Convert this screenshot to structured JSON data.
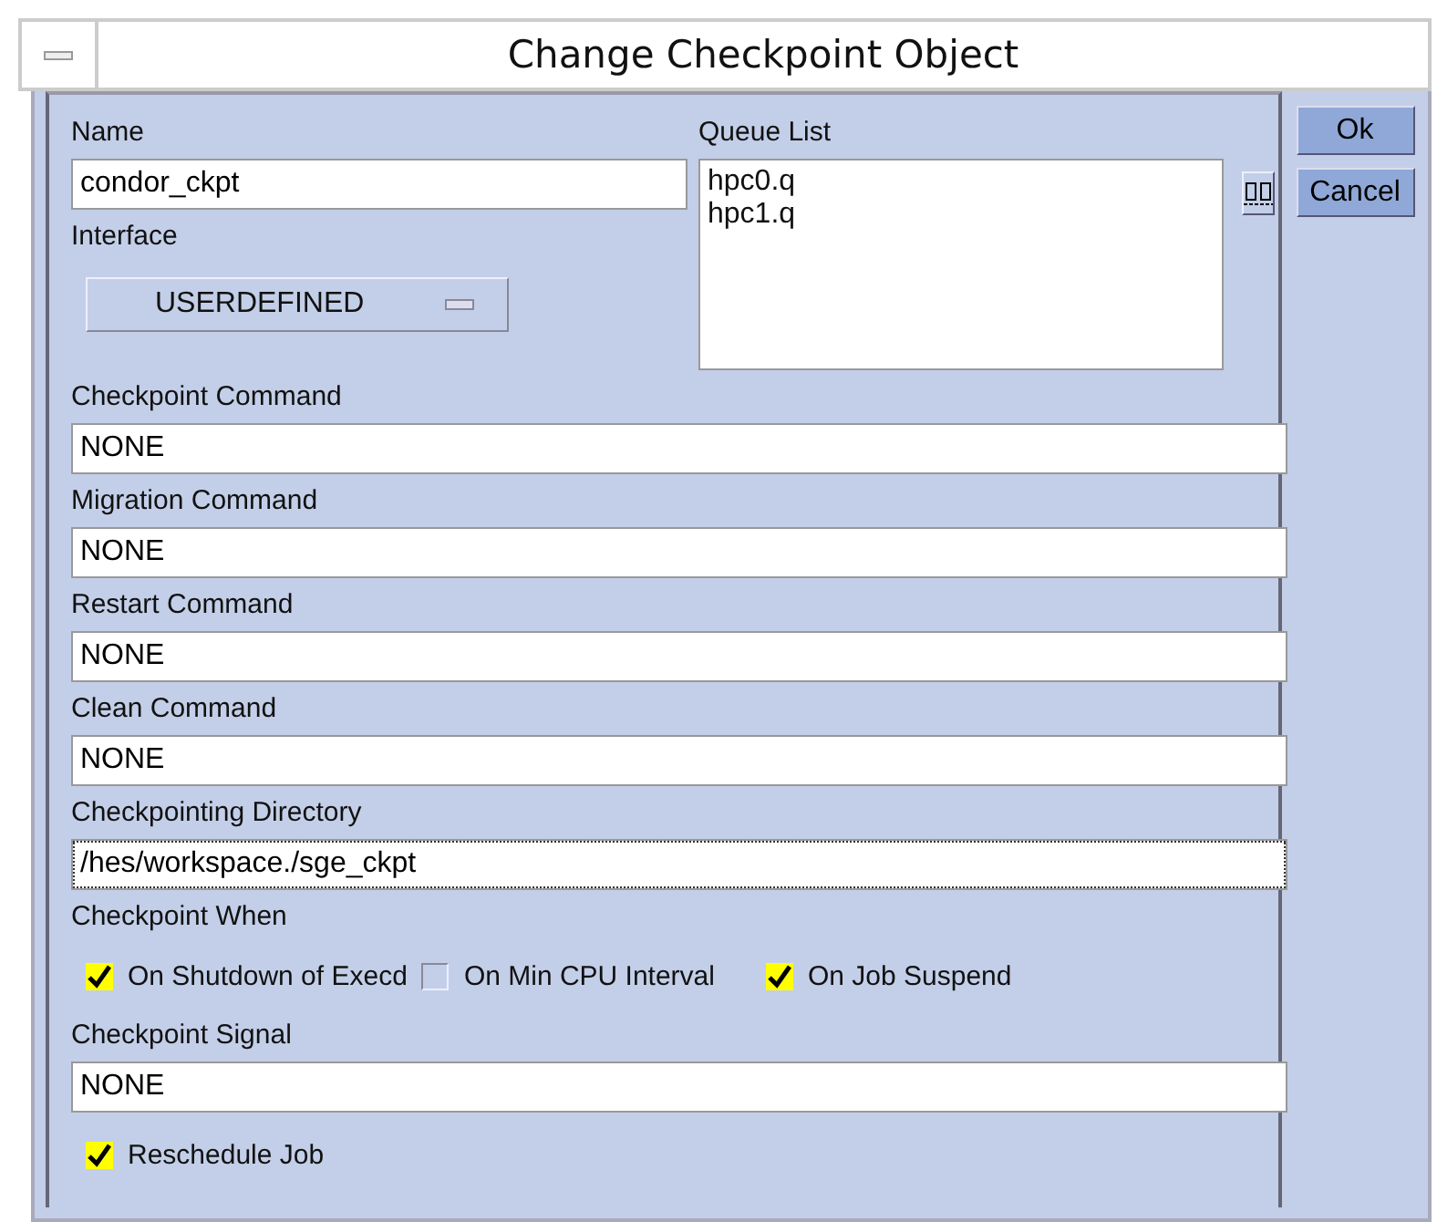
{
  "window": {
    "title": "Change Checkpoint Object"
  },
  "name": {
    "label": "Name",
    "value": "condor_ckpt"
  },
  "interface": {
    "label": "Interface",
    "value": "USERDEFINED"
  },
  "queue_list": {
    "label": "Queue List",
    "items": [
      "hpc0.q",
      "hpc1.q"
    ]
  },
  "fields": [
    {
      "label": "Checkpoint Command",
      "value": "NONE",
      "focused": false
    },
    {
      "label": "Migration Command",
      "value": "NONE",
      "focused": false
    },
    {
      "label": "Restart Command",
      "value": "NONE",
      "focused": false
    },
    {
      "label": "Clean Command",
      "value": "NONE",
      "focused": false
    },
    {
      "label": "Checkpointing Directory",
      "value": "/hes/workspace./sge_ckpt",
      "focused": true
    }
  ],
  "checkpoint_when": {
    "label": "Checkpoint When",
    "options": [
      {
        "label": "On Shutdown of Execd",
        "checked": true
      },
      {
        "label": "On Min CPU Interval",
        "checked": false
      },
      {
        "label": "On Job Suspend",
        "checked": true
      }
    ]
  },
  "signal": {
    "label": "Checkpoint Signal",
    "value": "NONE"
  },
  "reschedule": {
    "label": "Reschedule Job",
    "checked": true
  },
  "buttons": [
    "Ok",
    "Cancel"
  ]
}
